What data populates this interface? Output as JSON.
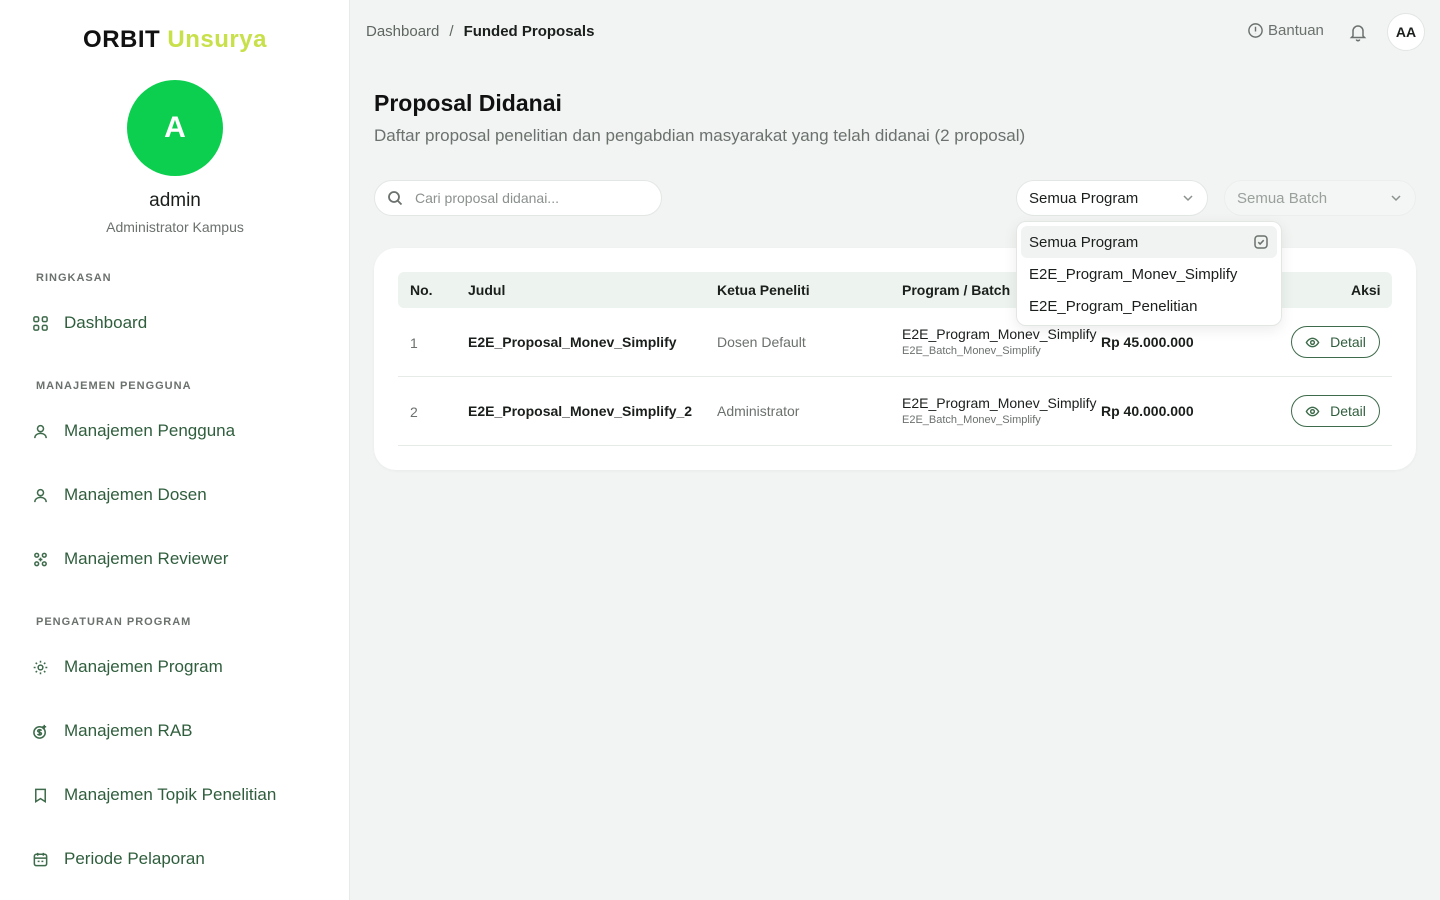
{
  "brand": {
    "part1": "ORBIT",
    "part2": "Unsurya",
    "accent_color": "#c8e04a"
  },
  "profile": {
    "initial": "A",
    "name": "admin",
    "role": "Administrator Kampus",
    "avatar_color": "#0ccf4f"
  },
  "sidebar": {
    "sections": [
      {
        "label": "RINGKASAN"
      },
      {
        "label": "MANAJEMEN PENGGUNA"
      },
      {
        "label": "PENGATURAN PROGRAM"
      }
    ],
    "items": [
      {
        "label": "Dashboard",
        "icon": "grid-icon"
      },
      {
        "label": "Manajemen Pengguna",
        "icon": "user-icon"
      },
      {
        "label": "Manajemen Dosen",
        "icon": "user-icon"
      },
      {
        "label": "Manajemen Reviewer",
        "icon": "users-network-icon"
      },
      {
        "label": "Manajemen Program",
        "icon": "gear-icon"
      },
      {
        "label": "Manajemen RAB",
        "icon": "money-icon"
      },
      {
        "label": "Manajemen Topik Penelitian",
        "icon": "bookmark-icon"
      },
      {
        "label": "Periode Pelaporan",
        "icon": "calendar-icon"
      }
    ]
  },
  "header": {
    "breadcrumb": {
      "root": "Dashboard",
      "separator": "/",
      "current": "Funded Proposals"
    },
    "help_label": "Bantuan",
    "user_initials": "AA"
  },
  "page": {
    "title": "Proposal Didanai",
    "subtitle": "Daftar proposal penelitian dan pengabdian masyarakat yang telah didanai (2 proposal)"
  },
  "filters": {
    "search_placeholder": "Cari proposal didanai...",
    "program_selected": "Semua Program",
    "batch_selected": "Semua Batch",
    "program_options": [
      "Semua Program",
      "E2E_Program_Monev_Simplify",
      "E2E_Program_Penelitian"
    ]
  },
  "table": {
    "headers": {
      "no": "No.",
      "judul": "Judul",
      "ketua": "Ketua Peneliti",
      "program": "Program / Batch",
      "aksi": "Aksi"
    },
    "rows": [
      {
        "no": "1",
        "judul": "E2E_Proposal_Monev_Simplify",
        "ketua": "Dosen Default",
        "program": "E2E_Program_Monev_Simplify",
        "batch": "E2E_Batch_Monev_Simplify",
        "dana": "Rp 45.000.000",
        "action": "Detail"
      },
      {
        "no": "2",
        "judul": "E2E_Proposal_Monev_Simplify_2",
        "ketua": "Administrator",
        "program": "E2E_Program_Monev_Simplify",
        "batch": "E2E_Batch_Monev_Simplify",
        "dana": "Rp 40.000.000",
        "action": "Detail"
      }
    ]
  }
}
